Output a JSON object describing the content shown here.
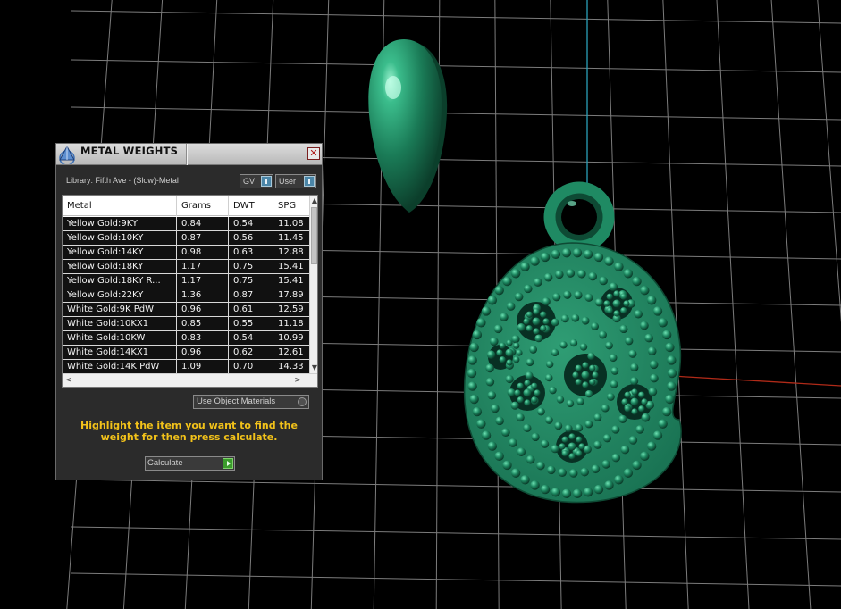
{
  "panel": {
    "title": "METAL WEIGHTS",
    "close_label": "✕",
    "library_label": "Library: Fifth Ave - (Slow)-Metal",
    "toggle_gv": "GV",
    "toggle_user": "User",
    "use_object_label": "Use Object Materials",
    "hint": "Highlight the item you want to find the weight for then press calculate.",
    "calculate_label": "Calculate"
  },
  "table": {
    "columns": [
      "Metal",
      "Grams",
      "DWT",
      "SPG"
    ],
    "rows": [
      [
        "Yellow Gold:9KY",
        "0.84",
        "0.54",
        "11.08"
      ],
      [
        "Yellow Gold:10KY",
        "0.87",
        "0.56",
        "11.45"
      ],
      [
        "Yellow Gold:14KY",
        "0.98",
        "0.63",
        "12.88"
      ],
      [
        "Yellow Gold:18KY",
        "1.17",
        "0.75",
        "15.41"
      ],
      [
        "Yellow Gold:18KY R...",
        "1.17",
        "0.75",
        "15.41"
      ],
      [
        "Yellow Gold:22KY",
        "1.36",
        "0.87",
        "17.89"
      ],
      [
        "White Gold:9K PdW",
        "0.96",
        "0.61",
        "12.59"
      ],
      [
        "White Gold:10KX1",
        "0.85",
        "0.55",
        "11.18"
      ],
      [
        "White Gold:10KW",
        "0.83",
        "0.54",
        "10.99"
      ],
      [
        "White Gold:14KX1",
        "0.96",
        "0.62",
        "12.61"
      ],
      [
        "White Gold:14K PdW",
        "1.09",
        "0.70",
        "14.33"
      ]
    ],
    "vscroll_up": "▲",
    "vscroll_down": "▼",
    "hscroll_left": "<",
    "hscroll_right": ">"
  },
  "colors": {
    "model_green": "#1f8a63",
    "grid_line": "#7c7c7c",
    "axis_blue": "#2aa0b8",
    "axis_red": "#b02a18",
    "hint_yellow": "#f2c21a"
  },
  "icons": {
    "panel_logo": "pyramid-logo-icon",
    "close": "close-icon",
    "toggle_indicator": "toggle-indicator-icon",
    "radio": "radio-icon",
    "go": "play-icon"
  }
}
